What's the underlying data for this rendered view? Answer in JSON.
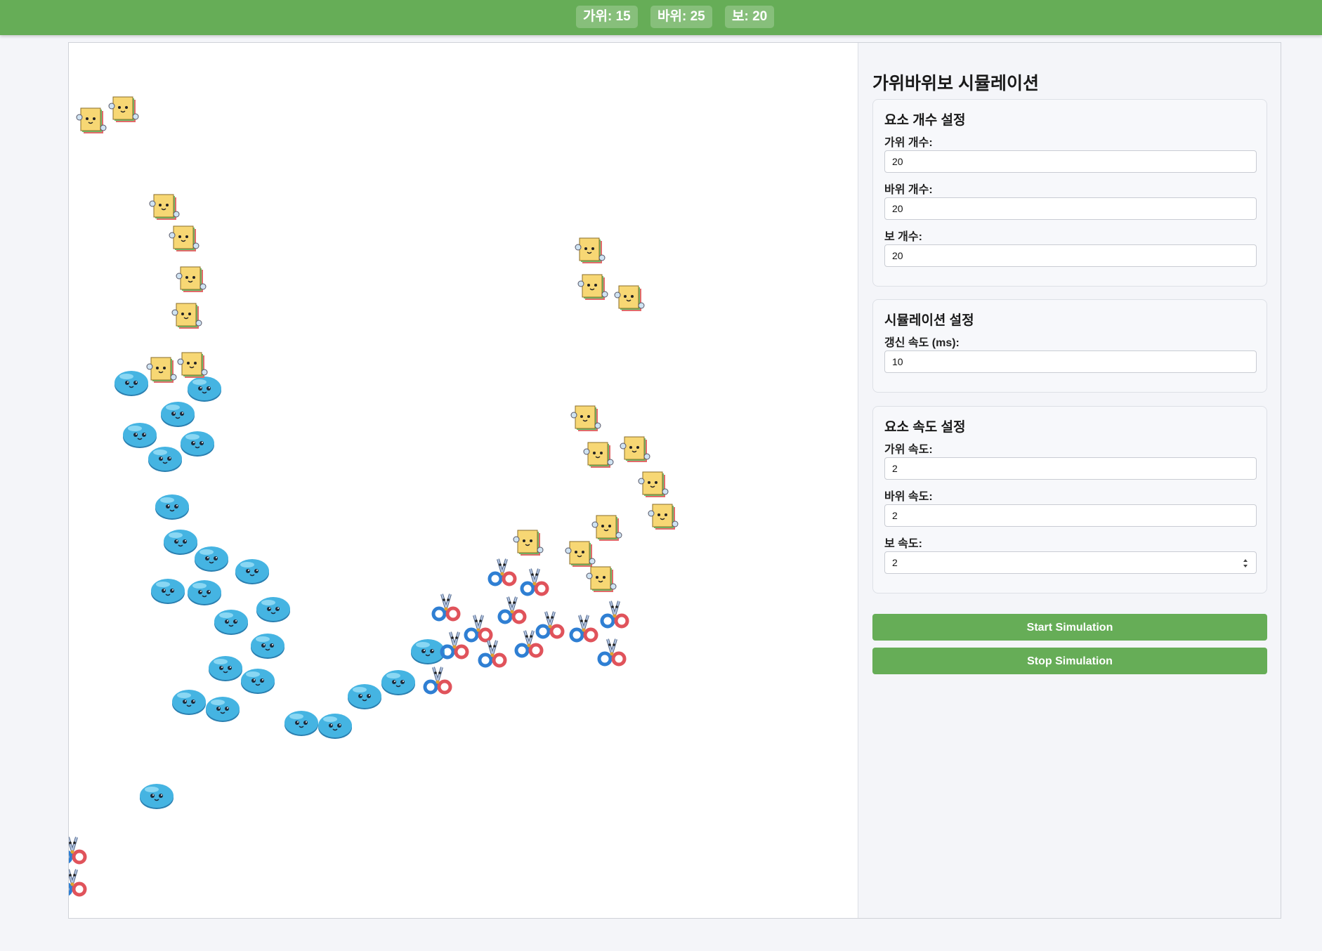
{
  "counters": {
    "scissors": "가위: 15",
    "rock": "바위: 25",
    "paper": "보: 20"
  },
  "panel": {
    "title": "가위바위보 시뮬레이션",
    "counts": {
      "title": "요소 개수 설정",
      "scissors_label": "가위 개수:",
      "scissors_value": "20",
      "rock_label": "바위 개수:",
      "rock_value": "20",
      "paper_label": "보 개수:",
      "paper_value": "20"
    },
    "simulation": {
      "title": "시뮬레이션 설정",
      "interval_label": "갱신 속도 (ms):",
      "interval_value": "10"
    },
    "speeds": {
      "title": "요소 속도 설정",
      "scissors_label": "가위 속도:",
      "scissors_value": "2",
      "rock_label": "바위 속도:",
      "rock_value": "2",
      "paper_label": "보 속도:",
      "paper_value": "2"
    },
    "start_label": "Start Simulation",
    "stop_label": "Stop Simulation"
  },
  "colors": {
    "accent": "#66ad57",
    "rock_fill": "#45b4e2",
    "paper_fill": "#f7d774",
    "scissors_left_ring": "#2f7fd3",
    "scissors_right_ring": "#e0535b"
  }
}
